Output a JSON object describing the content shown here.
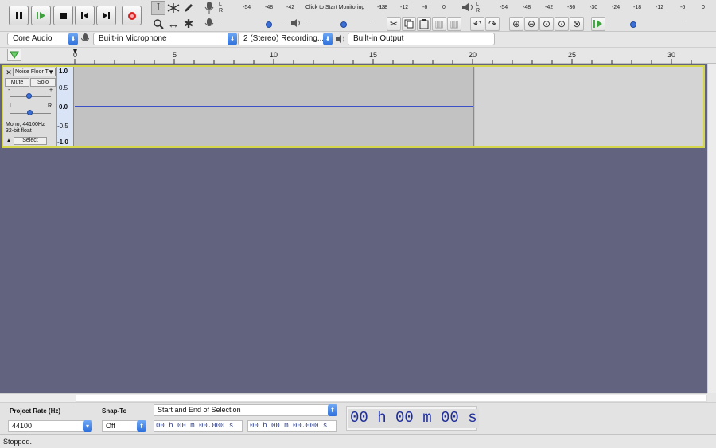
{
  "transport": {
    "pause": "pause-icon",
    "play": "play-icon",
    "stop": "stop-icon",
    "skip_start": "skip-start-icon",
    "skip_end": "skip-end-icon",
    "record": "record-icon"
  },
  "tools": {
    "selection": "I",
    "envelope": "envelope-icon",
    "draw": "pencil-icon",
    "zoom": "zoom-icon",
    "timeshift": "↔",
    "multi": "✱"
  },
  "record_meter": {
    "lr": "L\nR",
    "ticks": [
      "-54",
      "-48",
      "-42",
      "Click to Start Monitoring",
      "-18",
      "-12",
      "-6",
      "0"
    ]
  },
  "play_meter": {
    "lr": "L\nR",
    "ticks": [
      "-54",
      "-48",
      "-42",
      "-36",
      "-30",
      "-24",
      "-18",
      "-12",
      "-6",
      "0"
    ]
  },
  "devices": {
    "host": "Core Audio",
    "input": "Built-in Microphone",
    "channels": "2 (Stereo) Recording...",
    "output": "Built-in Output"
  },
  "ruler": {
    "ticks": [
      "0",
      "5",
      "10",
      "15",
      "20",
      "25",
      "30"
    ]
  },
  "track": {
    "name": "Noise Floor T",
    "mute": "Mute",
    "solo": "Solo",
    "gain_minus": "-",
    "gain_plus": "+",
    "pan_l": "L",
    "pan_r": "R",
    "info_line1": "Mono, 44100Hz",
    "info_line2": "32-bit float",
    "select": "Select",
    "scale": [
      "1.0",
      "0.5",
      "0.0",
      "-0.5",
      "-1.0"
    ]
  },
  "bottom": {
    "project_rate_label": "Project Rate (Hz)",
    "project_rate_value": "44100",
    "snap_label": "Snap-To",
    "snap_value": "Off",
    "selection_mode": "Start and End of Selection",
    "sel_start": "00 h 00 m 00.000 s",
    "sel_end": "00 h 00 m 00.000 s",
    "audio_pos": "00 h 00 m 00 s"
  },
  "status": "Stopped.",
  "colors": {
    "background": "#62647f",
    "waveform": "#3b4fc6",
    "track_border": "#d6d64a",
    "wave_bg": "#c2c2c2",
    "wave_bg_after": "#d4d4d4"
  }
}
